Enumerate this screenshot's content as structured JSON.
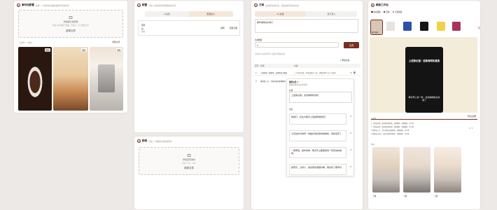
{
  "panel1": {
    "num": "1",
    "title": "素材池配置",
    "subtitle": "选择一个素材作为模板或者所有素材池",
    "drop_title": "添加图片或视频",
    "drop_hint": "建议上传清晰产品图，不超过，可以批量上传",
    "drop_button": "选择文件",
    "count_label": "已选择 3 个素材",
    "clear_link": "清除全部",
    "photos": [
      {
        "tag": "删除"
      },
      {
        "tag": "删除"
      },
      {
        "tag": "删除"
      }
    ]
  },
  "panel2": {
    "num": "2",
    "title": "配置",
    "subtitle": "为每个素材选择使用模板的方式",
    "seg_left": "AI设置",
    "seg_right": "配置达人",
    "field_label": "原则",
    "field_value": "语",
    "field_sub": "模板",
    "btn_a": "说明",
    "btn_b": "配置文档"
  },
  "panel2b": {
    "num": "3",
    "title": "配音",
    "subtitle": "可选，AI根据文案生成配音",
    "drop_title": "添加配音素材",
    "drop_hint": "支持 mp3、wav",
    "drop_button": "选择文件"
  },
  "panel3": {
    "num": "3",
    "title": "文案",
    "subtitle": "在这里生成文案，然后选择合适的文案",
    "seg_left": "AI 文案",
    "seg_right": "自己录入",
    "topic_value": "那杯咖啡太好喝了",
    "count_label": "生成数量",
    "count_value": "3",
    "generate": "生成",
    "hint": "可在Excel文件中导入或自行添加文案",
    "add_link": "+ 添加文案",
    "table_headers": [
      "序号",
      "标题",
      "内容"
    ],
    "rows": [
      {
        "idx": "1",
        "title": "上班的第一杯咖啡：这是我的小确幸",
        "content": "一大早起来第一件事就是冲一杯，浓郁的香气让人心情好"
      },
      {
        "idx": "2",
        "title": "咖啡机入手，今天开始在家做咖啡",
        "content": "编辑文案 1"
      }
    ],
    "editor_title": "编辑文案 1",
    "editor_sub": "根据需要修改文案内容",
    "editor_heading_label": "标题",
    "editor_heading": "上班族必备！这款咖啡机真香",
    "editor_body_label": "文案",
    "bubbles": [
      "我想打，还在为每天上班咖啡发愁吗？",
      "今天给你们种草一款超好用的家用咖啡机，真的爱死了",
      "一键萃取，操作简单，每天早上都能喝到一杯香浓的咖啡，",
      "颜值高，占地小，放在厨房里超好看，朋友来了都夸好"
    ]
  },
  "panel4": {
    "num": "4",
    "title": "模板工作台",
    "opt_a": "白底模板",
    "opt_b": "竖版",
    "opt_c": "全部模板",
    "swatches": [
      {
        "label": "暖色模板",
        "color": "#d9c7b3"
      },
      {
        "label": "",
        "color": "#e7e2dd"
      },
      {
        "label": "",
        "color": "#2e4fa8"
      },
      {
        "label": "",
        "color": "#161616"
      },
      {
        "label": "",
        "color": "#f1d247"
      },
      {
        "label": "",
        "color": "#a8345c"
      }
    ],
    "preview_title": "上班族必备！这款咖啡机真香",
    "preview_body": "每天早上来一杯，这款咖啡机太好用了",
    "list_header_a": "已选择",
    "list_header_b": "导出全部",
    "list_items": [
      "1 上班族必备！这款咖啡机真香，效率翻倍 · 竖版模板 · 带字幕",
      "2 上班族必备！这款咖啡机真香，效率翻倍 · 竖版模板 · 带字幕",
      "3 咖啡机入手，今天开始在家做咖啡 · 竖版模板 · 带字幕",
      "4 颜值高占地小，厨房必备好物推荐 · 竖版模板 · 带字幕"
    ],
    "list_count": "4 / 4",
    "export_label": "导出",
    "thumbs": [
      {
        "label": "下载"
      },
      {
        "label": "下载"
      },
      {
        "label": "下载"
      }
    ]
  },
  "colors": {
    "accent": "#7a2e22",
    "cream": "#f4e8da"
  }
}
